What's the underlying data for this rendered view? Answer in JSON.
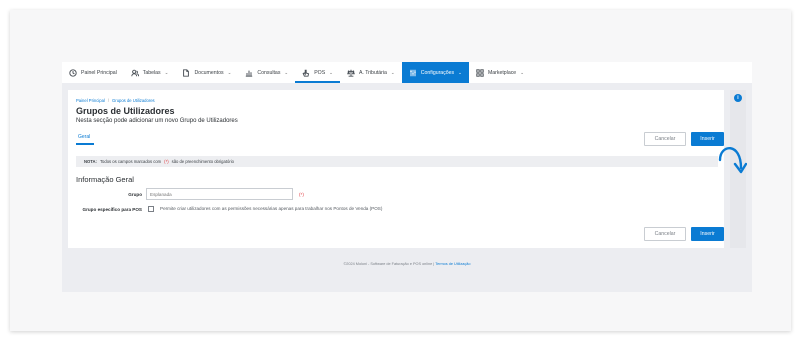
{
  "nav": {
    "items": [
      {
        "label": "Painel Principal",
        "icon": "clock-icon",
        "chevron": ""
      },
      {
        "label": "Tabelas",
        "icon": "users-icon",
        "chevron": "⌄"
      },
      {
        "label": "Documentos",
        "icon": "document-icon",
        "chevron": "⌄"
      },
      {
        "label": "Consultas",
        "icon": "bar-chart-icon",
        "chevron": "⌄"
      },
      {
        "label": "POS",
        "icon": "hand-icon",
        "chevron": "⌄"
      },
      {
        "label": "A. Tributária",
        "icon": "scales-icon",
        "chevron": "⌄"
      },
      {
        "label": "Configurações",
        "icon": "sliders-icon",
        "chevron": "⌄"
      },
      {
        "label": "Marketplace",
        "icon": "grid-icon",
        "chevron": "⌄"
      }
    ]
  },
  "breadcrumb": {
    "home": "Painel Principal",
    "sep": "/",
    "current": "Grupos de Utilizadores"
  },
  "page": {
    "title": "Grupos de Utilizadores",
    "subtitle": "Nesta secção pode adicionar um novo Grupo de Utilizadores",
    "tab": "Geral"
  },
  "buttons": {
    "cancel": "Cancelar",
    "insert": "Inserir"
  },
  "note": {
    "label": "NOTA:",
    "text_before": "Todos os campos marcados com",
    "required_mark": "(*)",
    "text_after": "são de preenchimento obrigatório"
  },
  "section": {
    "title": "Informação Geral"
  },
  "form": {
    "group_label": "Grupo",
    "group_value": "Esplanada",
    "required_mark": "(*)",
    "pos_label": "Grupo específico para POS",
    "pos_checkbox_text": "Permite criar utilizadores com as permissões necessárias apenas para trabalhar nos Pontos de Venda (POS)"
  },
  "footer": {
    "text": "©2024 Moloni - Software de Faturação e POS online |",
    "link": "Termos de Utilização"
  },
  "info_badge": "i",
  "colors": {
    "accent": "#0a7bd3",
    "required": "#e0353b"
  }
}
